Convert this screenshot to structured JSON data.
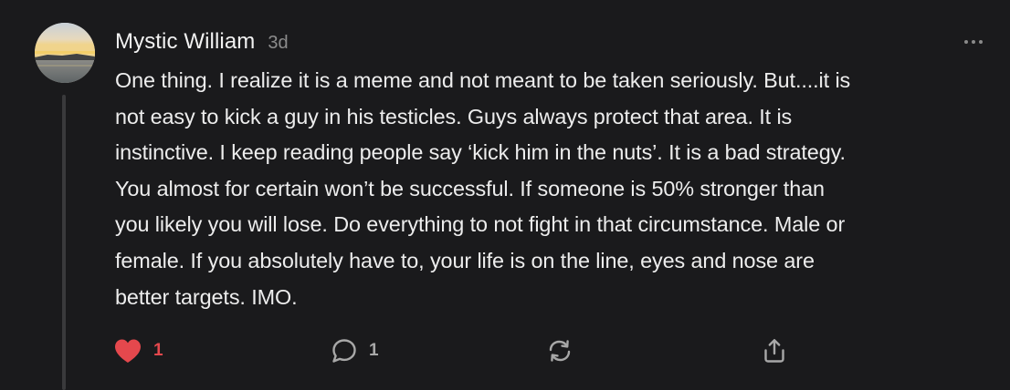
{
  "comment": {
    "author": "Mystic William",
    "time_ago": "3d",
    "avatar_icon": "landscape-sunset-avatar",
    "lines": [
      "One thing. I realize it is a meme and not meant to be taken seriously. But....it is",
      "not easy to kick a guy in his testicles. Guys always protect that area. It is",
      "instinctive. I keep reading people say ‘kick him in the nuts’. It is a bad strategy.",
      "You almost for certain won’t be successful. If someone is 50% stronger than",
      "you likely you will lose. Do everything to not fight in that circumstance. Male or",
      "female. If you absolutely have to, your life is on the line, eyes and nose are",
      "better targets. IMO."
    ]
  },
  "actions": {
    "like": {
      "icon": "heart-icon",
      "count": "1",
      "color": "#e5484d"
    },
    "reply": {
      "icon": "speech-bubble-icon",
      "count": "1"
    },
    "restack": {
      "icon": "restack-icon"
    },
    "share": {
      "icon": "share-icon"
    },
    "more": {
      "icon": "more-options-icon"
    }
  },
  "colors": {
    "background": "#1a1a1c",
    "text": "#ededed",
    "muted": "#8c8c8c",
    "like_active": "#e5484d"
  }
}
